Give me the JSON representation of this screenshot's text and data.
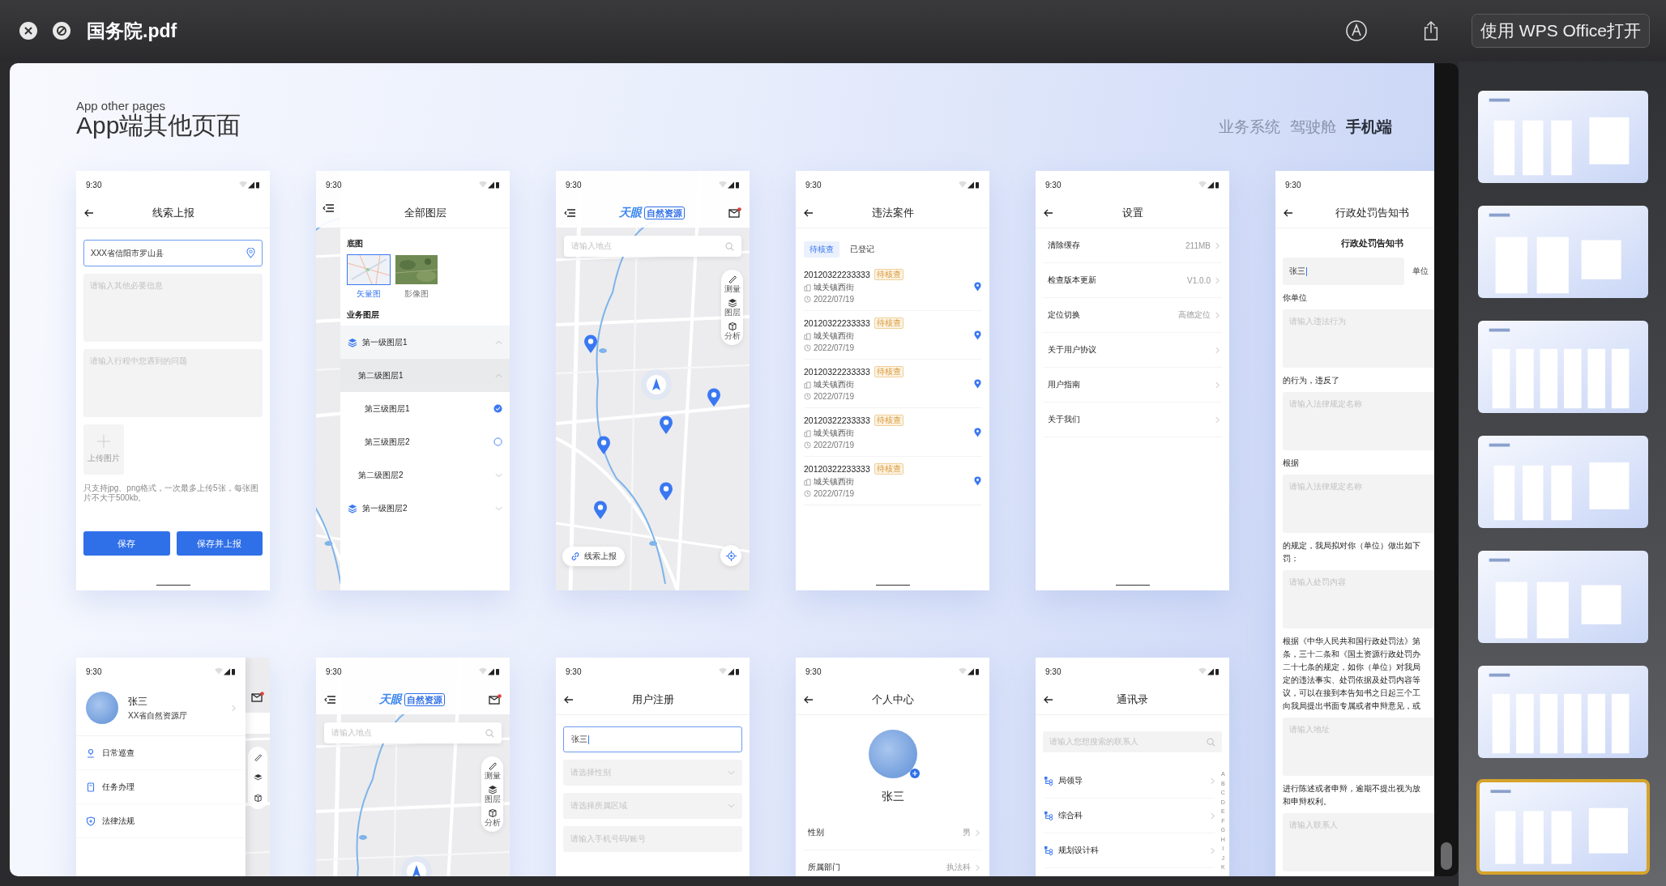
{
  "viewer": {
    "title": "国务院.pdf",
    "open_button": "使用 WPS Office打开"
  },
  "slide": {
    "subtitle": "App other pages",
    "title": "App端其他页面",
    "nav": [
      {
        "label": "业务系统",
        "selected": false
      },
      {
        "label": "驾驶舱",
        "selected": false
      },
      {
        "label": "手机端",
        "selected": true
      }
    ],
    "screens": [
      {
        "kind": "report",
        "time": "9:30",
        "title": "线索上报",
        "location": "XXX省信阳市罗山县",
        "fields": [
          {
            "placeholder": "请输入其他必要信息"
          },
          {
            "placeholder": "请输入行程中您遇到的问题"
          }
        ],
        "upload": "上传图片",
        "hint": "只支持jpg、png格式，一次最多上传5张，每张图片不大于500kb。",
        "buttons": [
          "保存",
          "保存并上报"
        ]
      },
      {
        "kind": "layers",
        "time": "9:30",
        "title": "全部图层",
        "base_label": "底图",
        "base_maps": [
          {
            "label": "矢量图",
            "selected": true
          },
          {
            "label": "影像图",
            "selected": false
          }
        ],
        "section": "业务图层",
        "layers": [
          {
            "label": "第一级图层1",
            "expanded": true,
            "children": [
              {
                "label": "第二级图层1",
                "expanded": true,
                "children": [
                  {
                    "label": "第三级图层1",
                    "checked": true
                  },
                  {
                    "label": "第三级图层2",
                    "checked": false
                  }
                ]
              },
              {
                "label": "第二级图层2",
                "expanded": false
              }
            ]
          },
          {
            "label": "第一级图层2",
            "expanded": false
          }
        ]
      },
      {
        "kind": "map",
        "time": "9:30",
        "logo": "天眼",
        "logo_badge": "自然资源",
        "search": {
          "placeholder": "请输入地点"
        },
        "tools": [
          "测量",
          "图层",
          "分析"
        ],
        "markers": true,
        "report_button": "线索上报"
      },
      {
        "kind": "cases",
        "time": "9:30",
        "title": "违法案件",
        "tabs": [
          {
            "label": "待核查",
            "selected": true
          },
          {
            "label": "已登记",
            "selected": false
          }
        ],
        "cases": [
          {
            "id": "20120322233333",
            "status": "待核查",
            "place": "城关镇西街",
            "date": "2022/07/19"
          },
          {
            "id": "20120322233333",
            "status": "待核查",
            "place": "城关镇西街",
            "date": "2022/07/19"
          },
          {
            "id": "20120322233333",
            "status": "待核查",
            "place": "城关镇西街",
            "date": "2022/07/19"
          },
          {
            "id": "20120322233333",
            "status": "待核查",
            "place": "城关镇西街",
            "date": "2022/07/19"
          },
          {
            "id": "20120322233333",
            "status": "待核查",
            "place": "城关镇西街",
            "date": "2022/07/19"
          }
        ]
      },
      {
        "kind": "settings",
        "time": "9:30",
        "title": "设置",
        "items": [
          {
            "label": "清除缓存",
            "value": "211MB"
          },
          {
            "label": "检查版本更新",
            "value": "V1.0.0"
          },
          {
            "label": "定位切换",
            "value": "高德定位"
          },
          {
            "label": "关于用户协议"
          },
          {
            "label": "用户指南"
          },
          {
            "label": "关于我们"
          }
        ]
      },
      {
        "kind": "notice",
        "time": "9:30",
        "title": "行政处罚告知书",
        "heading": "行政处罚告知书",
        "name_value": "张三",
        "side_label": "单位",
        "blocks": [
          {
            "kind": "text",
            "lines": [
              "你单位"
            ]
          },
          {
            "kind": "area",
            "placeholder": "请输入违法行为"
          },
          {
            "kind": "text",
            "lines": [
              "的行为，违反了"
            ]
          },
          {
            "kind": "area",
            "placeholder": "请输入法律规定名称"
          },
          {
            "kind": "text",
            "lines": [
              "根据"
            ]
          },
          {
            "kind": "area",
            "placeholder": "请输入法律规定名称"
          },
          {
            "kind": "text",
            "lines": [
              "的规定，我局拟对你（单位）做出如下",
              "罚："
            ]
          },
          {
            "kind": "area",
            "placeholder": "请输入处罚内容"
          },
          {
            "kind": "text",
            "lines": [
              "根据《中华人民共和国行政处罚法》第",
              "条，三十二条和《国土资源行政处罚办",
              "二十七条的规定，如你（单位）对我局",
              "定的违法事实、处罚依据及处罚内容等",
              "议，可以在接到本告知书之日起三个工",
              "向我局提出书面专属或者申辩意见，或"
            ]
          },
          {
            "kind": "area",
            "placeholder": "请输入地址"
          },
          {
            "kind": "text",
            "lines": [
              "进行陈述或者申辩，逾期不提出视为放",
              "和申辩权利。"
            ]
          },
          {
            "kind": "area",
            "placeholder": "请输入联系人"
          }
        ]
      },
      {
        "kind": "drawer",
        "time": "9:30",
        "user": {
          "name": "张三",
          "org": "XX省自然资源厅"
        },
        "menu": [
          "日常巡查",
          "任务办理",
          "法律法规"
        ]
      },
      {
        "kind": "map",
        "time": "9:30",
        "logo": "天眼",
        "logo_badge": "自然资源",
        "search": {
          "placeholder": "请输入地点"
        },
        "tools": [
          "测量",
          "图层",
          "分析"
        ]
      },
      {
        "kind": "register",
        "time": "9:30",
        "title": "用户注册",
        "fields": [
          {
            "kind": "text",
            "value": "张三"
          },
          {
            "kind": "select",
            "placeholder": "请选择性别"
          },
          {
            "kind": "select",
            "placeholder": "请选择所属区域"
          },
          {
            "kind": "input",
            "placeholder": "请输入手机号码/账号"
          }
        ]
      },
      {
        "kind": "profile",
        "time": "9:30",
        "title": "个人中心",
        "name": "张三",
        "rows": [
          {
            "label": "性别",
            "value": "男"
          },
          {
            "label": "所属部门",
            "value": "执法科"
          }
        ]
      },
      {
        "kind": "contacts",
        "time": "9:30",
        "title": "通讯录",
        "search": {
          "placeholder": "请输入您想搜索的联系人"
        },
        "groups": [
          "局领导",
          "综合科",
          "规划设计科"
        ],
        "index": [
          "A",
          "B",
          "C",
          "D",
          "E",
          "F",
          "G",
          "H",
          "I",
          "J",
          "K"
        ]
      }
    ]
  },
  "thumbnails": [
    {
      "selected": false
    },
    {
      "selected": false
    },
    {
      "selected": false
    },
    {
      "selected": false
    },
    {
      "selected": false
    },
    {
      "selected": false
    },
    {
      "selected": true
    }
  ]
}
